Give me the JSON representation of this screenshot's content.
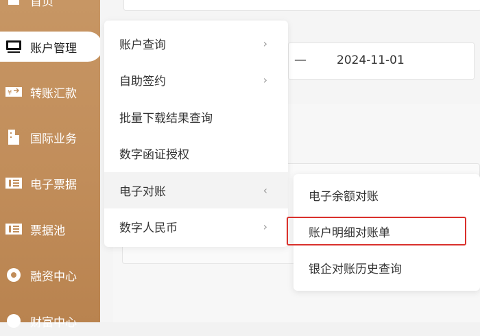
{
  "sidebar": {
    "items": [
      {
        "label": "首页",
        "icon": "home-icon"
      },
      {
        "label": "账户管理",
        "icon": "monitor-icon"
      },
      {
        "label": "转账汇款",
        "icon": "transfer-icon"
      },
      {
        "label": "国际业务",
        "icon": "building-icon"
      },
      {
        "label": "电子票据",
        "icon": "bill-icon"
      },
      {
        "label": "票据池",
        "icon": "bill-pool-icon"
      },
      {
        "label": "融资中心",
        "icon": "finance-icon"
      },
      {
        "label": "财富中心",
        "icon": "wealth-icon"
      }
    ]
  },
  "date_range": {
    "end_date": "2024-11-01"
  },
  "account_menu": {
    "items": [
      {
        "label": "账户查询"
      },
      {
        "label": "自助签约"
      },
      {
        "label": "批量下载结果查询"
      },
      {
        "label": "数字函证授权"
      },
      {
        "label": "电子对账"
      },
      {
        "label": "数字人民币"
      }
    ]
  },
  "reconciliation_submenu": {
    "items": [
      {
        "label": "电子余额对账"
      },
      {
        "label": "账户明细对账单"
      },
      {
        "label": "银企对账历史查询"
      }
    ]
  },
  "colors": {
    "sidebar": "#c18d5a",
    "highlight": "#d9302b"
  }
}
